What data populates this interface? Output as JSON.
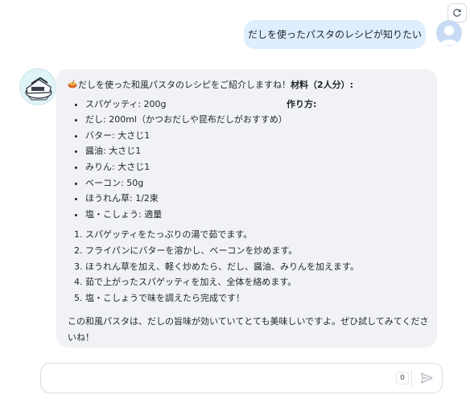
{
  "header": {
    "refresh_icon": "refresh-icon"
  },
  "user_message": {
    "text": "だしを使ったパスタのレシピが知りたい",
    "avatar_icon": "user-avatar-icon"
  },
  "bot_message": {
    "avatar_icon": "bot-avatar-icon",
    "intro_icon": "pasta-emoji-icon",
    "intro_text": "だしを使った和風パスタのレシピをご紹介しますね！",
    "ingredients_heading": "材料（2人分）:",
    "ingredients": [
      "スパゲッティ: 200g",
      "だし: 200ml（かつおだしや昆布だしがおすすめ）",
      "バター: 大さじ1",
      "醤油: 大さじ1",
      "みりん: 大さじ1",
      "ベーコン: 50g",
      "ほうれん草: 1/2束",
      "塩・こしょう: 適量"
    ],
    "steps_heading": "作り方:",
    "steps": [
      "スパゲッティをたっぷりの湯で茹でます。",
      "フライパンにバターを溶かし、ベーコンを炒めます。",
      "ほうれん草を加え、軽く炒めたら、だし、醤油、みりんを加えます。",
      "茹で上がったスパゲッティを加え、全体を絡めます。",
      "塩・こしょうで味を調えたら完成です！"
    ],
    "closing": "この和風パスタは、だしの旨味が効いていてとても美味しいですよ。ぜひ試してみてくださいね！"
  },
  "composer": {
    "value": "",
    "char_count": "0",
    "send_icon": "send-icon"
  }
}
